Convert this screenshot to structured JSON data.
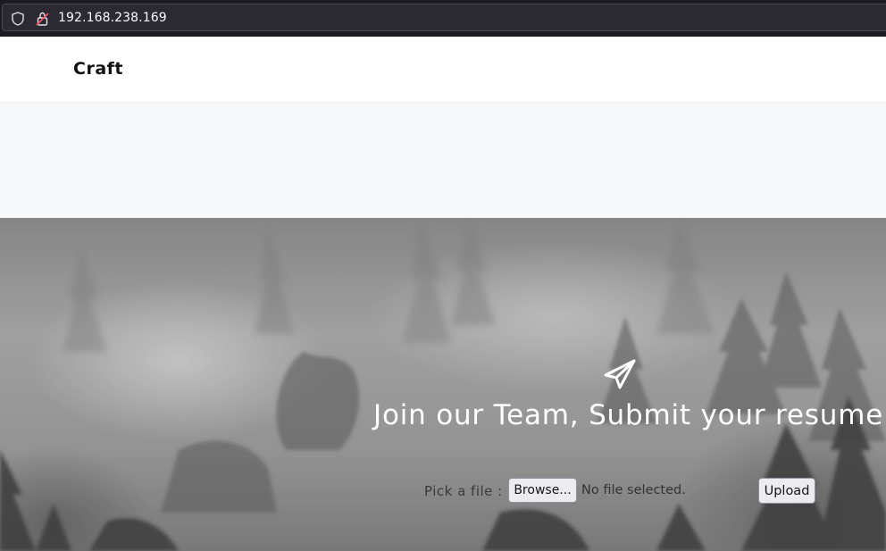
{
  "browser": {
    "url": "192.168.238.169",
    "icons": [
      "shield-icon",
      "lock-icon"
    ]
  },
  "navbar": {
    "brand": "Craft"
  },
  "hero": {
    "icon": "paper-plane-icon",
    "title": "Join our Team, Submit your resume !",
    "form": {
      "pick_label": "Pick a file :",
      "browse_label": "Browse...",
      "file_status": "No file selected.",
      "upload_label": "Upload"
    }
  }
}
